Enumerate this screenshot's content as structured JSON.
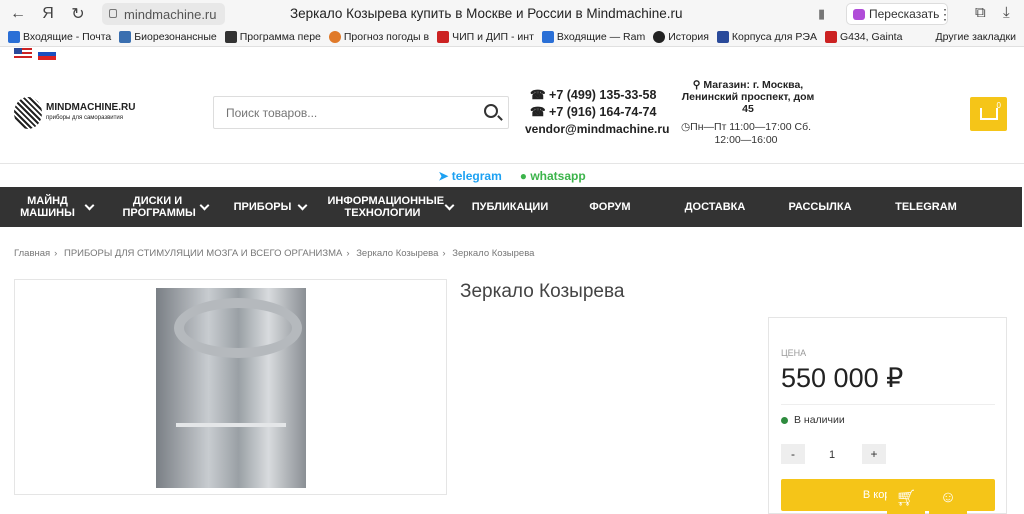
{
  "browser": {
    "url": "mindmachine.ru",
    "title": "Зеркало Козырева купить в Москве и России в Mindmachine.ru",
    "retell": "Пересказать"
  },
  "bookmarks": {
    "items": [
      "Входящие - Почта",
      "Биорезонансные",
      "Программа пере",
      "Прогноз погоды в",
      "ЧИП и ДИП - инт",
      "Входящие — Ram",
      "История",
      "Корпуса для РЭА",
      "G434, Gainta"
    ],
    "other": "Другие закладки"
  },
  "header": {
    "logo": "MINDMACHINE.RU",
    "logo_sub": "приборы для саморазвития",
    "search_placeholder": "Поиск товаров...",
    "phone1": "+7 (499) 135-33-58",
    "phone2": "+7 (916) 164-74-74",
    "email": "vendor@mindmachine.ru",
    "shop": "Магазин: г. Москва, Ленинский проспект, дом 45",
    "hours": "Пн—Пт 11:00—17:00 Сб. 12:00—16:00",
    "cart_count": "0"
  },
  "social": {
    "telegram": "telegram",
    "whatsapp": "whatsapp"
  },
  "menu": [
    "МАЙНД МАШИНЫ",
    "ДИСКИ И ПРОГРАММЫ",
    "ПРИБОРЫ",
    "ИНФОРМАЦИОННЫЕ ТЕХНОЛОГИИ",
    "ПУБЛИКАЦИИ",
    "ФОРУМ",
    "ДОСТАВКА",
    "РАССЫЛКА",
    "TELEGRAM"
  ],
  "breadcrumbs": [
    "Главная",
    "ПРИБОРЫ ДЛЯ СТИМУЛЯЦИИ МОЗГА И ВСЕГО ОРГАНИЗМА",
    "Зеркало Козырева",
    "Зеркало Козырева"
  ],
  "product": {
    "title": "Зеркало Козырева",
    "price_label": "ЦЕНА",
    "price": "550 000 ₽",
    "stock": "В наличии",
    "qty": "1",
    "minus": "-",
    "plus": "+",
    "buy": "В корзину"
  }
}
